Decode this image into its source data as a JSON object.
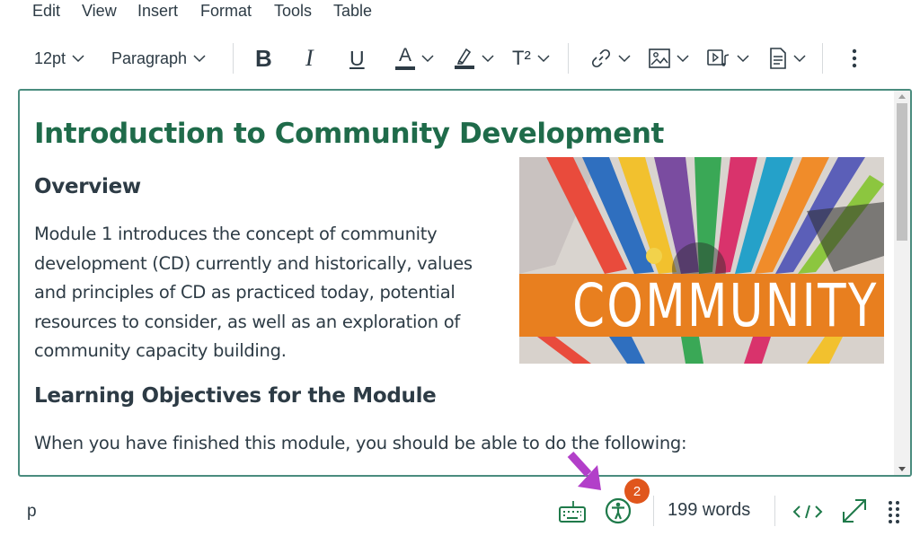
{
  "menu": [
    "Edit",
    "View",
    "Insert",
    "Format",
    "Tools",
    "Table"
  ],
  "toolbar": {
    "font_size": "12pt",
    "block_format": "Paragraph",
    "bold_label": "B",
    "italic_label": "I",
    "underline_label": "U",
    "text_color_label": "A",
    "superscript_label": "T²",
    "icons": [
      "bold-icon",
      "italic-icon",
      "underline-icon",
      "text-color-icon",
      "highlight-icon",
      "superscript-icon",
      "link-icon",
      "image-icon",
      "media-icon",
      "document-icon",
      "more-icon"
    ],
    "text_color": "#2d3b45",
    "highlight_color": "#2d3b45"
  },
  "document": {
    "title": "Introduction to Community Development",
    "overview_heading": "Overview",
    "overview_lines": [
      "Module 1 introduces the concept of community",
      "development (CD) currently and historically, values",
      "and principles of CD as practiced today, potential",
      "resources to consider, as well as an exploration of",
      "community capacity building."
    ],
    "objectives_heading": "Learning Objectives for the Module",
    "objectives_intro": "When you have finished this module, you should be able to do the following:",
    "image_word": "COMMUNITY",
    "image_banner_color": "#e87f1f",
    "heading_color": "#1f6b4a"
  },
  "status": {
    "path": "p",
    "word_count": "199 words",
    "accessibility_issues": "2",
    "badge_color": "#e0561c",
    "arrow_color": "#b23fc9",
    "icons": [
      "keyboard-icon",
      "accessibility-icon",
      "html-code-icon",
      "fullscreen-icon",
      "drag-handle-icon"
    ]
  }
}
